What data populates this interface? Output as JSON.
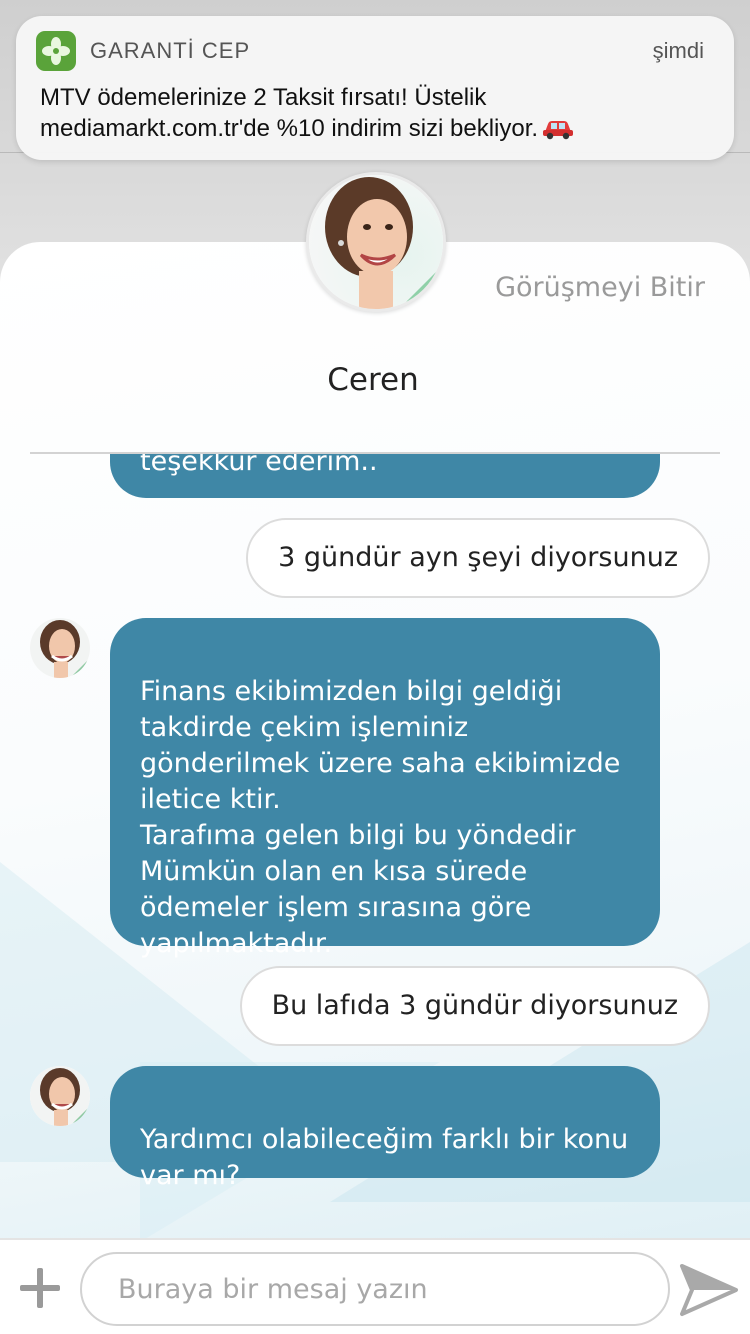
{
  "notification": {
    "app_name": "GARANTİ CEP",
    "time": "şimdi",
    "line1": "MTV ödemelerinize 2 Taksit fırsatı! Üstelik",
    "line2": "mediamarkt.com.tr'de %10 indirim sizi bekliyor.",
    "app_icon": "clover-icon",
    "emoji_icon": "car-icon",
    "brand_color": "#5aa33a"
  },
  "header": {
    "end_chat_label": "Görüşmeyi Bitir",
    "agent_name": "Ceren"
  },
  "messages": [
    {
      "sender": "agent",
      "text": "teşekkür ederim.."
    },
    {
      "sender": "user",
      "text": "3 gündür ayn şeyi diyorsunuz"
    },
    {
      "sender": "agent",
      "text": "Finans ekibimizden bilgi geldiği\ntakdirde çekim işleminiz\ngönderilmek üzere saha ekibimizde\niletice ktir.\nTarafıma gelen bilgi bu yöndedir\nMümkün olan en kısa sürede\nödemeler işlem sırasına göre\nyapılmaktadır."
    },
    {
      "sender": "user",
      "text": "Bu lafıda 3 gündür diyorsunuz"
    },
    {
      "sender": "agent",
      "text": "Yardımcı olabileceğim farklı bir konu\nvar mı?"
    }
  ],
  "input": {
    "placeholder": "Buraya bir mesaj yazın",
    "value": ""
  },
  "colors": {
    "agent_bubble": "#3f87a6",
    "user_bubble": "#ffffff"
  }
}
